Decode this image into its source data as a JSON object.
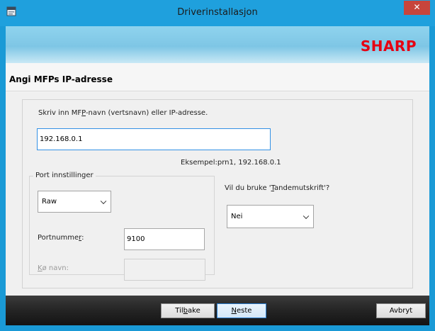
{
  "window": {
    "title": "Driverinstallasjon",
    "close_glyph": "✕"
  },
  "banner": {
    "logo": "SHARP"
  },
  "page": {
    "title": "Angi MFPs IP-adresse"
  },
  "address": {
    "label_before": "Skriv inn MF",
    "label_mnemonic": "P",
    "label_after": "-navn (vertsnavn) eller IP-adresse.",
    "value": "192.168.0.1",
    "example": "Eksempel:prn1, 192.168.0.1"
  },
  "port_settings": {
    "legend": "Port innstillinger",
    "type_selected": "Raw",
    "port_label_before": "Portnumme",
    "port_label_mnemonic": "r",
    "port_label_after": ":",
    "port_value": "9100",
    "queue_label_before": "K",
    "queue_label_mnemonic": "ø",
    "queue_label_after": " navn:",
    "queue_value": ""
  },
  "tandem": {
    "question_before": "Vil du bruke '",
    "question_mnemonic": "T",
    "question_after": "andemutskrift'?",
    "selected": "Nei"
  },
  "footer": {
    "back_before": "Til",
    "back_mnemonic": "b",
    "back_after": "ake",
    "next_mnemonic": "N",
    "next_after": "este",
    "cancel": "Avbryt"
  },
  "colors": {
    "title_bar": "#1fa0dd",
    "close_button": "#c7453c",
    "logo_red": "#e60012",
    "focus_border": "#3391e5"
  }
}
